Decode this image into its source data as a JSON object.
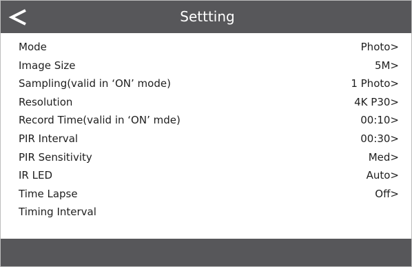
{
  "header": {
    "title": "Settting",
    "back_icon": "chevron-left-icon"
  },
  "settings": [
    {
      "label": "Mode",
      "value": "Photo>"
    },
    {
      "label": "Image Size",
      "value": "5M>"
    },
    {
      "label": "Sampling(valid in ‘ON’ mode)",
      "value": "1 Photo>"
    },
    {
      "label": "Resolution",
      "value": "4K P30>"
    },
    {
      "label": "Record Time(valid in ‘ON’ mde)",
      "value": "00:10>"
    },
    {
      "label": "PIR Interval",
      "value": "00:30>"
    },
    {
      "label": "PIR Sensitivity",
      "value": "Med>"
    },
    {
      "label": "IR LED",
      "value": "Auto>"
    },
    {
      "label": "Time Lapse",
      "value": "Off>"
    },
    {
      "label": "Timing Interval",
      "value": ""
    }
  ],
  "colors": {
    "bar": "#57575a",
    "text": "#1e1e1e",
    "background": "#ffffff"
  }
}
